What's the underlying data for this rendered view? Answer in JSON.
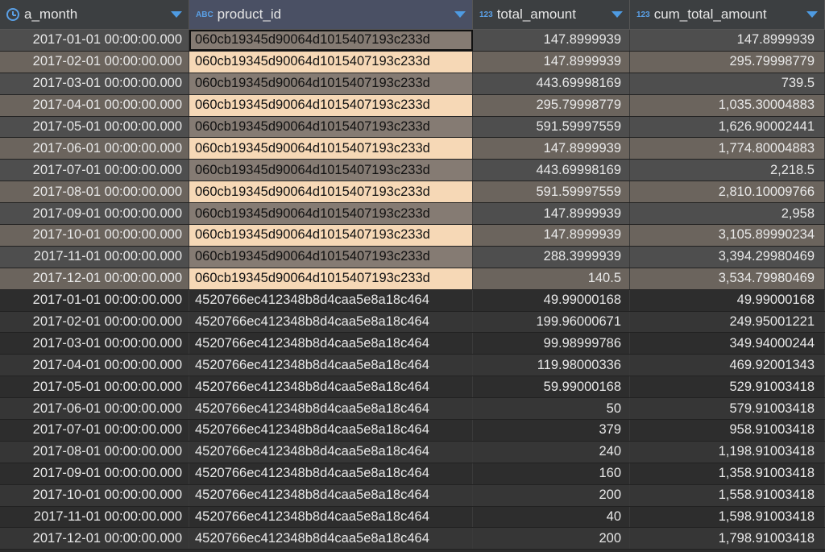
{
  "columns": [
    {
      "label": "a_month",
      "type_icon": "clock-icon"
    },
    {
      "label": "product_id",
      "type_icon": "ABC"
    },
    {
      "label": "total_amount",
      "type_icon": "123"
    },
    {
      "label": "cum_total_amount",
      "type_icon": "123"
    }
  ],
  "rows": [
    {
      "a_month": "2017-01-01 00:00:00.000",
      "product_id": "060cb19345d90064d1015407193c233d",
      "total_amount": "147.8999939",
      "cum_total_amount": "147.8999939"
    },
    {
      "a_month": "2017-02-01 00:00:00.000",
      "product_id": "060cb19345d90064d1015407193c233d",
      "total_amount": "147.8999939",
      "cum_total_amount": "295.79998779"
    },
    {
      "a_month": "2017-03-01 00:00:00.000",
      "product_id": "060cb19345d90064d1015407193c233d",
      "total_amount": "443.69998169",
      "cum_total_amount": "739.5"
    },
    {
      "a_month": "2017-04-01 00:00:00.000",
      "product_id": "060cb19345d90064d1015407193c233d",
      "total_amount": "295.79998779",
      "cum_total_amount": "1,035.30004883"
    },
    {
      "a_month": "2017-05-01 00:00:00.000",
      "product_id": "060cb19345d90064d1015407193c233d",
      "total_amount": "591.59997559",
      "cum_total_amount": "1,626.90002441"
    },
    {
      "a_month": "2017-06-01 00:00:00.000",
      "product_id": "060cb19345d90064d1015407193c233d",
      "total_amount": "147.8999939",
      "cum_total_amount": "1,774.80004883"
    },
    {
      "a_month": "2017-07-01 00:00:00.000",
      "product_id": "060cb19345d90064d1015407193c233d",
      "total_amount": "443.69998169",
      "cum_total_amount": "2,218.5"
    },
    {
      "a_month": "2017-08-01 00:00:00.000",
      "product_id": "060cb19345d90064d1015407193c233d",
      "total_amount": "591.59997559",
      "cum_total_amount": "2,810.10009766"
    },
    {
      "a_month": "2017-09-01 00:00:00.000",
      "product_id": "060cb19345d90064d1015407193c233d",
      "total_amount": "147.8999939",
      "cum_total_amount": "2,958"
    },
    {
      "a_month": "2017-10-01 00:00:00.000",
      "product_id": "060cb19345d90064d1015407193c233d",
      "total_amount": "147.8999939",
      "cum_total_amount": "3,105.89990234"
    },
    {
      "a_month": "2017-11-01 00:00:00.000",
      "product_id": "060cb19345d90064d1015407193c233d",
      "total_amount": "288.3999939",
      "cum_total_amount": "3,394.29980469"
    },
    {
      "a_month": "2017-12-01 00:00:00.000",
      "product_id": "060cb19345d90064d1015407193c233d",
      "total_amount": "140.5",
      "cum_total_amount": "3,534.79980469"
    },
    {
      "a_month": "2017-01-01 00:00:00.000",
      "product_id": "4520766ec412348b8d4caa5e8a18c464",
      "total_amount": "49.99000168",
      "cum_total_amount": "49.99000168"
    },
    {
      "a_month": "2017-02-01 00:00:00.000",
      "product_id": "4520766ec412348b8d4caa5e8a18c464",
      "total_amount": "199.96000671",
      "cum_total_amount": "249.95001221"
    },
    {
      "a_month": "2017-03-01 00:00:00.000",
      "product_id": "4520766ec412348b8d4caa5e8a18c464",
      "total_amount": "99.98999786",
      "cum_total_amount": "349.94000244"
    },
    {
      "a_month": "2017-04-01 00:00:00.000",
      "product_id": "4520766ec412348b8d4caa5e8a18c464",
      "total_amount": "119.98000336",
      "cum_total_amount": "469.92001343"
    },
    {
      "a_month": "2017-05-01 00:00:00.000",
      "product_id": "4520766ec412348b8d4caa5e8a18c464",
      "total_amount": "59.99000168",
      "cum_total_amount": "529.91003418"
    },
    {
      "a_month": "2017-06-01 00:00:00.000",
      "product_id": "4520766ec412348b8d4caa5e8a18c464",
      "total_amount": "50",
      "cum_total_amount": "579.91003418"
    },
    {
      "a_month": "2017-07-01 00:00:00.000",
      "product_id": "4520766ec412348b8d4caa5e8a18c464",
      "total_amount": "379",
      "cum_total_amount": "958.91003418"
    },
    {
      "a_month": "2017-08-01 00:00:00.000",
      "product_id": "4520766ec412348b8d4caa5e8a18c464",
      "total_amount": "240",
      "cum_total_amount": "1,198.91003418"
    },
    {
      "a_month": "2017-09-01 00:00:00.000",
      "product_id": "4520766ec412348b8d4caa5e8a18c464",
      "total_amount": "160",
      "cum_total_amount": "1,358.91003418"
    },
    {
      "a_month": "2017-10-01 00:00:00.000",
      "product_id": "4520766ec412348b8d4caa5e8a18c464",
      "total_amount": "200",
      "cum_total_amount": "1,558.91003418"
    },
    {
      "a_month": "2017-11-01 00:00:00.000",
      "product_id": "4520766ec412348b8d4caa5e8a18c464",
      "total_amount": "40",
      "cum_total_amount": "1,598.91003418"
    },
    {
      "a_month": "2017-12-01 00:00:00.000",
      "product_id": "4520766ec412348b8d4caa5e8a18c464",
      "total_amount": "200",
      "cum_total_amount": "1,798.91003418"
    }
  ],
  "colors": {
    "header_bg": "#3c3f41",
    "selected_header_bg": "#4a5064",
    "accent": "#4e9be2",
    "highlight_cell": "#f6d8b6"
  }
}
